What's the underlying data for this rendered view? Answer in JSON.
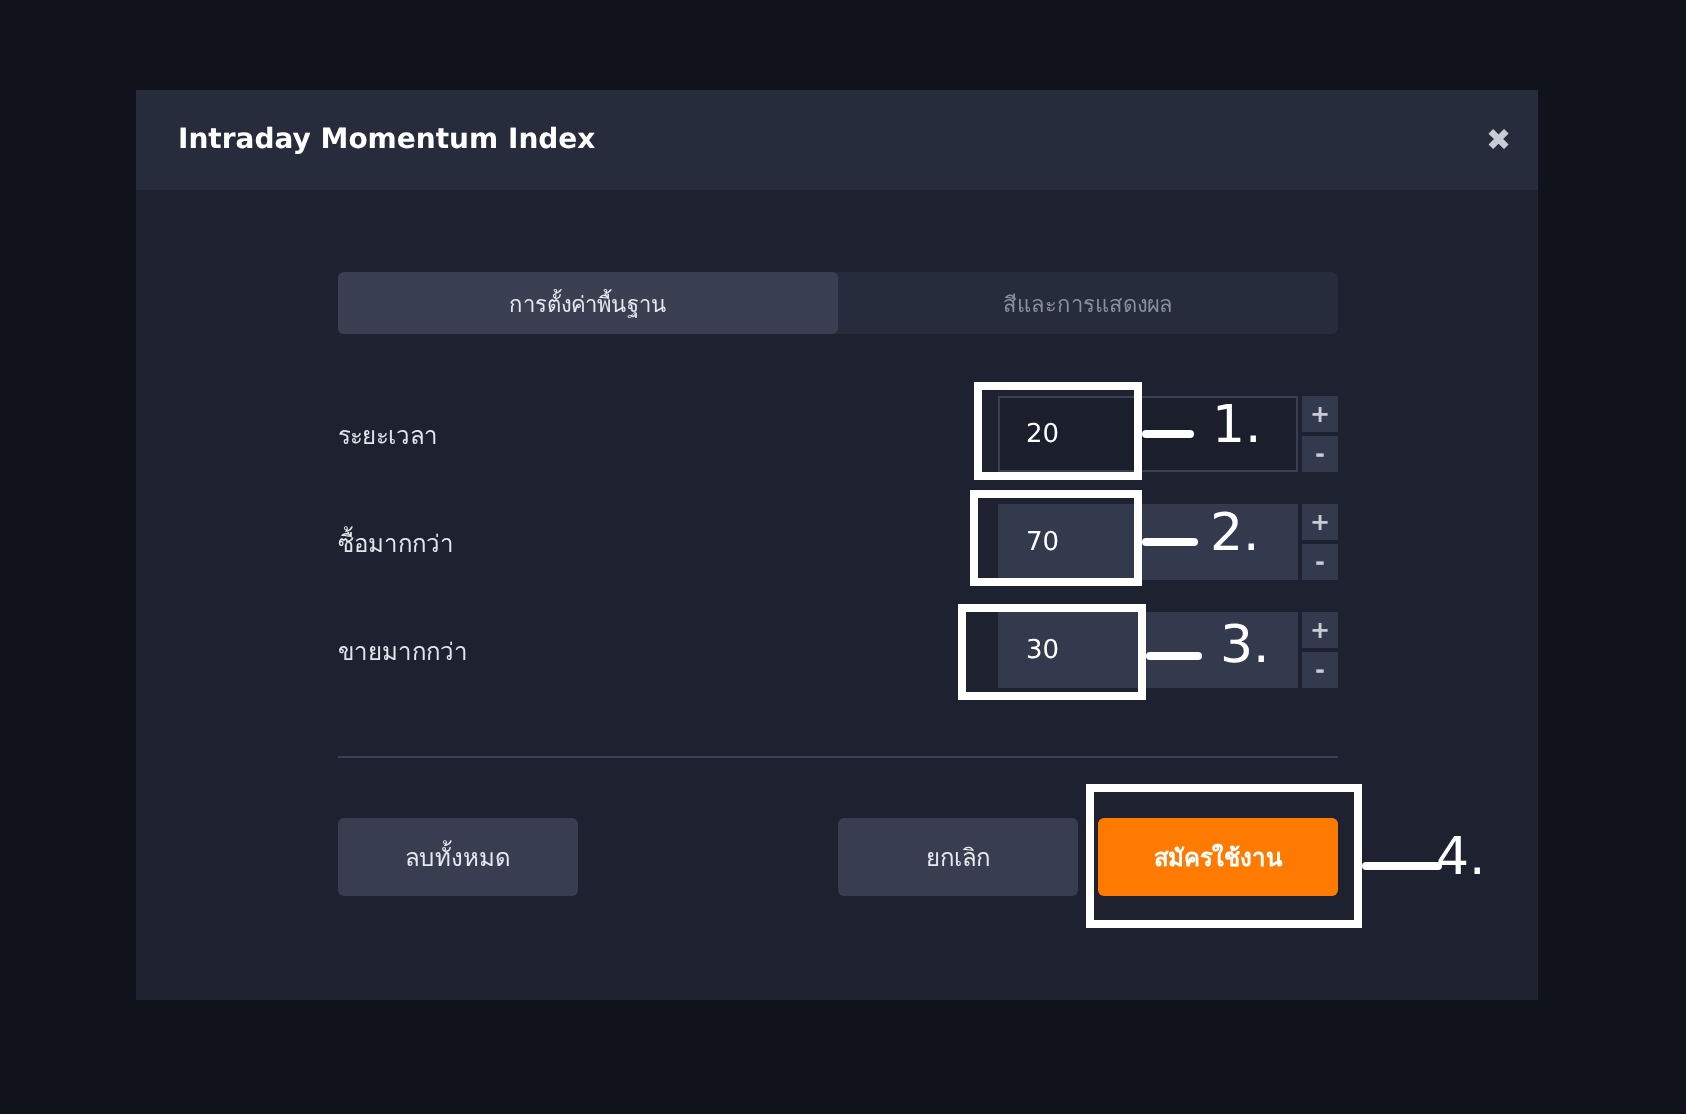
{
  "window": {
    "title": "Intraday Momentum Index",
    "close": "✖"
  },
  "tabs": [
    {
      "label": "การตั้งค่าพื้นฐาน",
      "selected": true
    },
    {
      "label": "สีและการแสดงผล",
      "selected": false
    }
  ],
  "fields": [
    {
      "label": "ระยะเวลา",
      "value": "20",
      "focused": true,
      "plus": "+",
      "minus": "-"
    },
    {
      "label": "ซื้อมากกว่า",
      "value": "70",
      "focused": false,
      "plus": "+",
      "minus": "-"
    },
    {
      "label": "ขายมากกว่า",
      "value": "30",
      "focused": false,
      "plus": "+",
      "minus": "-"
    }
  ],
  "buttons": [
    {
      "label": "ลบทั้งหมด",
      "kind": "secondary"
    },
    {
      "label": "ยกเลิก",
      "kind": "secondary"
    },
    {
      "label": "สมัครใช้งาน",
      "kind": "primary"
    }
  ],
  "annotations": [
    {
      "label": "1."
    },
    {
      "label": "2."
    },
    {
      "label": "3."
    },
    {
      "label": "4."
    }
  ]
}
